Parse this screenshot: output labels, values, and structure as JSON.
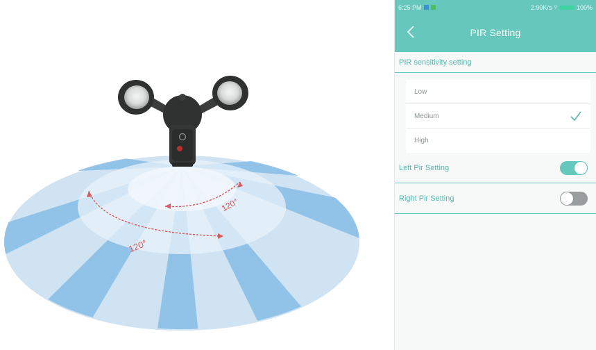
{
  "illustration": {
    "angle_inner": "120°",
    "angle_outer": "120°"
  },
  "status_bar": {
    "time": "6:25 PM",
    "network_speed": "2.90K/s",
    "battery": "100%"
  },
  "header": {
    "back_icon": "chevron-left-icon",
    "title": "PIR Setting"
  },
  "sensitivity": {
    "section_label": "PIR sensitivity setting",
    "options": [
      {
        "label": "Low",
        "selected": false
      },
      {
        "label": "Medium",
        "selected": true
      },
      {
        "label": "High",
        "selected": false
      }
    ]
  },
  "left_pir": {
    "label": "Left Pir Setting",
    "enabled": true
  },
  "right_pir": {
    "label": "Right Pir Setting",
    "enabled": false
  },
  "colors": {
    "accent": "#66c7bd",
    "beam_blue": "#7fb8e4",
    "arrow_red": "#d85a5a"
  }
}
